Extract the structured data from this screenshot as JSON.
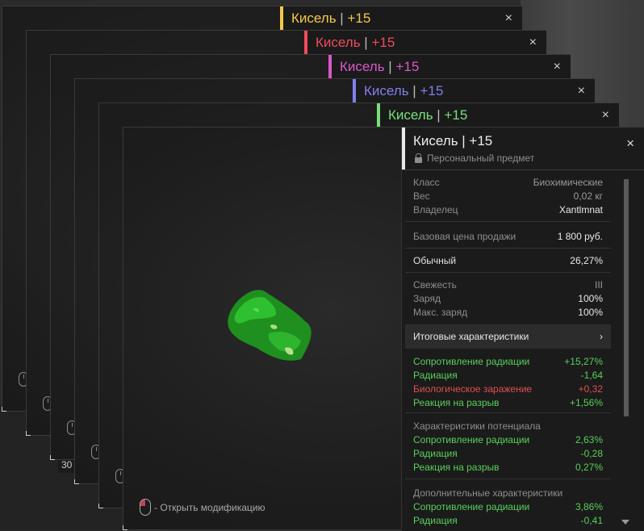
{
  "background": {
    "tag": "30"
  },
  "stack": [
    {
      "title_name": "Кисель",
      "title_sep": " | ",
      "title_level": "+15",
      "accent": "#f2c94c"
    },
    {
      "title_name": "Кисель",
      "title_sep": " | ",
      "title_level": "+15",
      "accent": "#ef4b5c"
    },
    {
      "title_name": "Кисель",
      "title_sep": " | ",
      "title_level": "+15",
      "accent": "#d858c8"
    },
    {
      "title_name": "Кисель",
      "title_sep": " | ",
      "title_level": "+15",
      "accent": "#7f7ff0"
    },
    {
      "title_name": "Кисель",
      "title_sep": " | ",
      "title_level": "+15",
      "accent": "#78e078"
    }
  ],
  "close_glyph": "×",
  "panel": {
    "title": "Кисель | +15",
    "subtitle": "Персональный предмет",
    "info": [
      {
        "k": "Класс",
        "v": "Биохимические"
      },
      {
        "k": "Вес",
        "v": "0,02 кг"
      },
      {
        "k": "Владелец",
        "v": "Xantlmnat"
      }
    ],
    "price": {
      "k": "Базовая цена продажи",
      "v": "1 800 руб."
    },
    "rarity": {
      "k": "Обычный",
      "v": "26,27%"
    },
    "state": [
      {
        "k": "Свежесть",
        "v": "III"
      },
      {
        "k": "Заряд",
        "v": "100%"
      },
      {
        "k": "Макс. заряд",
        "v": "100%"
      }
    ],
    "summary_button": {
      "label": "Итоговые характеристики",
      "arrow": "›"
    },
    "totals": [
      {
        "k": "Сопротивление радиации",
        "v": "+15,27%",
        "color": "green"
      },
      {
        "k": "Радиация",
        "v": "-1,64",
        "color": "green"
      },
      {
        "k": "Биологическое заражение",
        "v": "+0,32",
        "color": "red"
      },
      {
        "k": "Реакция на разрыв",
        "v": "+1,56%",
        "color": "green"
      }
    ],
    "potential_header": "Характеристики потенциала",
    "potential": [
      {
        "k": "Сопротивление радиации",
        "v": "2,63%",
        "color": "green"
      },
      {
        "k": "Радиация",
        "v": "-0,28",
        "color": "green"
      },
      {
        "k": "Реакция на разрыв",
        "v": "0,27%",
        "color": "green"
      }
    ],
    "extra_header": "Дополнительные характеристики",
    "extra": [
      {
        "k": "Сопротивление радиации",
        "v": "3,86%",
        "color": "green"
      },
      {
        "k": "Радиация",
        "v": "-0,41",
        "color": "green"
      }
    ]
  },
  "hint": {
    "text": "- Открыть модификацию"
  }
}
